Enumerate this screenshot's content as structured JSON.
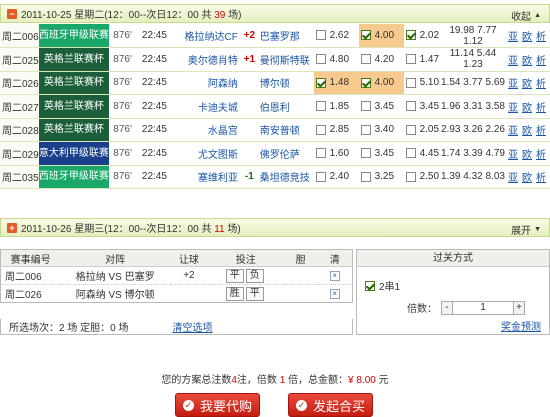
{
  "day1": {
    "date_text": "2011-10-25 星期二(12：00--次日12：00 共 ",
    "count": "39",
    "date_suffix": " 场)",
    "toggle_label": "收起",
    "matches": [
      {
        "no": "周二006",
        "league": "西班牙甲级联赛",
        "league_color": "#19a86a",
        "mid": "876'",
        "time": "22:45",
        "home": "格拉纳达CF",
        "hc": "+2",
        "hc_color": "#d40000",
        "away": "巴塞罗那",
        "o1": "2.62",
        "o1_on": false,
        "o2": "4.00",
        "o2_on": true,
        "o3": "2.02",
        "o3_on": true,
        "ex1": "19.98 7.77",
        "ex2": "1.12",
        "l1": "亚",
        "l2": "欧",
        "l3": "析"
      },
      {
        "no": "周二025",
        "league": "英格兰联赛杯",
        "league_color": "#1b5e3a",
        "mid": "876'",
        "time": "22:45",
        "home": "奥尔德肖特",
        "hc": "+1",
        "hc_color": "#d40000",
        "away": "曼彻斯特联",
        "o1": "4.80",
        "o1_on": false,
        "o2": "4.20",
        "o2_on": false,
        "o3": "1.47",
        "o3_on": false,
        "ex1": "11.14 5.44",
        "ex2": "1.23",
        "l1": "亚",
        "l2": "欧",
        "l3": "析"
      },
      {
        "no": "周二026",
        "league": "英格兰联赛杯",
        "league_color": "#1b5e3a",
        "mid": "876'",
        "time": "22:45",
        "home": "阿森纳",
        "hc": "",
        "hc_color": "#333",
        "away": "博尔顿",
        "o1": "1.48",
        "o1_on": true,
        "o2": "4.00",
        "o2_on": true,
        "o3": "5.10",
        "o3_on": false,
        "ex1": "1.54 3.77 5.69",
        "ex2": "",
        "l1": "亚",
        "l2": "欧",
        "l3": "析"
      },
      {
        "no": "周二027",
        "league": "英格兰联赛杯",
        "league_color": "#1b5e3a",
        "mid": "876'",
        "time": "22:45",
        "home": "卡迪夫城",
        "hc": "",
        "hc_color": "#333",
        "away": "伯恩利",
        "o1": "1.85",
        "o1_on": false,
        "o2": "3.45",
        "o2_on": false,
        "o3": "3.45",
        "o3_on": false,
        "ex1": "1.96 3.31 3.58",
        "ex2": "",
        "l1": "亚",
        "l2": "欧",
        "l3": "析"
      },
      {
        "no": "周二028",
        "league": "英格兰联赛杯",
        "league_color": "#1b5e3a",
        "mid": "876'",
        "time": "22:45",
        "home": "水晶宫",
        "hc": "",
        "hc_color": "#333",
        "away": "南安普顿",
        "o1": "2.85",
        "o1_on": false,
        "o2": "3.40",
        "o2_on": false,
        "o3": "2.05",
        "o3_on": false,
        "ex1": "2.93 3.26 2.26",
        "ex2": "",
        "l1": "亚",
        "l2": "欧",
        "l3": "析"
      },
      {
        "no": "周二029",
        "league": "意大利甲级联赛",
        "league_color": "#1a3f8a",
        "mid": "876'",
        "time": "22:45",
        "home": "尤文图斯",
        "hc": "",
        "hc_color": "#333",
        "away": "佛罗伦萨",
        "o1": "1.60",
        "o1_on": false,
        "o2": "3.45",
        "o2_on": false,
        "o3": "4.45",
        "o3_on": false,
        "ex1": "1.74 3.39 4.79",
        "ex2": "",
        "l1": "亚",
        "l2": "欧",
        "l3": "析"
      },
      {
        "no": "周二035",
        "league": "西班牙甲级联赛",
        "league_color": "#19a86a",
        "mid": "876'",
        "time": "22:45",
        "home": "塞维利亚",
        "hc": "-1",
        "hc_color": "#0a7a00",
        "away": "桑坦德竞技",
        "o1": "2.40",
        "o1_on": false,
        "o2": "3.25",
        "o2_on": false,
        "o3": "2.50",
        "o3_on": false,
        "ex1": "1.39 4.32 8.03",
        "ex2": "",
        "l1": "亚",
        "l2": "欧",
        "l3": "析"
      }
    ]
  },
  "day2": {
    "date_text": "2011-10-26 星期三(12：00--次日12：00 共 ",
    "count": "11",
    "date_suffix": " 场)",
    "toggle_label": "展开"
  },
  "selection": {
    "headers": [
      "赛事编号",
      "对阵",
      "让球",
      "投注",
      "胆",
      "清"
    ],
    "rows": [
      {
        "no": "周二006",
        "home": "格拉纳",
        "vs": "VS",
        "away": "巴塞罗",
        "hc": "+2",
        "bets": [
          "平",
          "负"
        ]
      },
      {
        "no": "周二026",
        "home": "阿森纳",
        "vs": "VS",
        "away": "博尔顿",
        "hc": "",
        "bets": [
          "胜",
          "平"
        ]
      }
    ],
    "footer": "所选场次：2 场  定胆：0 场",
    "clear_label": "清空选项"
  },
  "pass": {
    "header": "过关方式",
    "option": "2串1",
    "times_label": "倍数：",
    "minus": "-",
    "times_value": "1",
    "plus": "+",
    "prize_link": "奖金预测"
  },
  "summary": {
    "p1": "您的方案总注数",
    "notes": "4",
    "p2": "注，倍数 ",
    "times": "1",
    "p3": " 倍，总金额：",
    "amount": "¥ 8.00",
    "p4": " 元"
  },
  "buttons": {
    "buy": "我要代购",
    "group": "发起合买"
  }
}
